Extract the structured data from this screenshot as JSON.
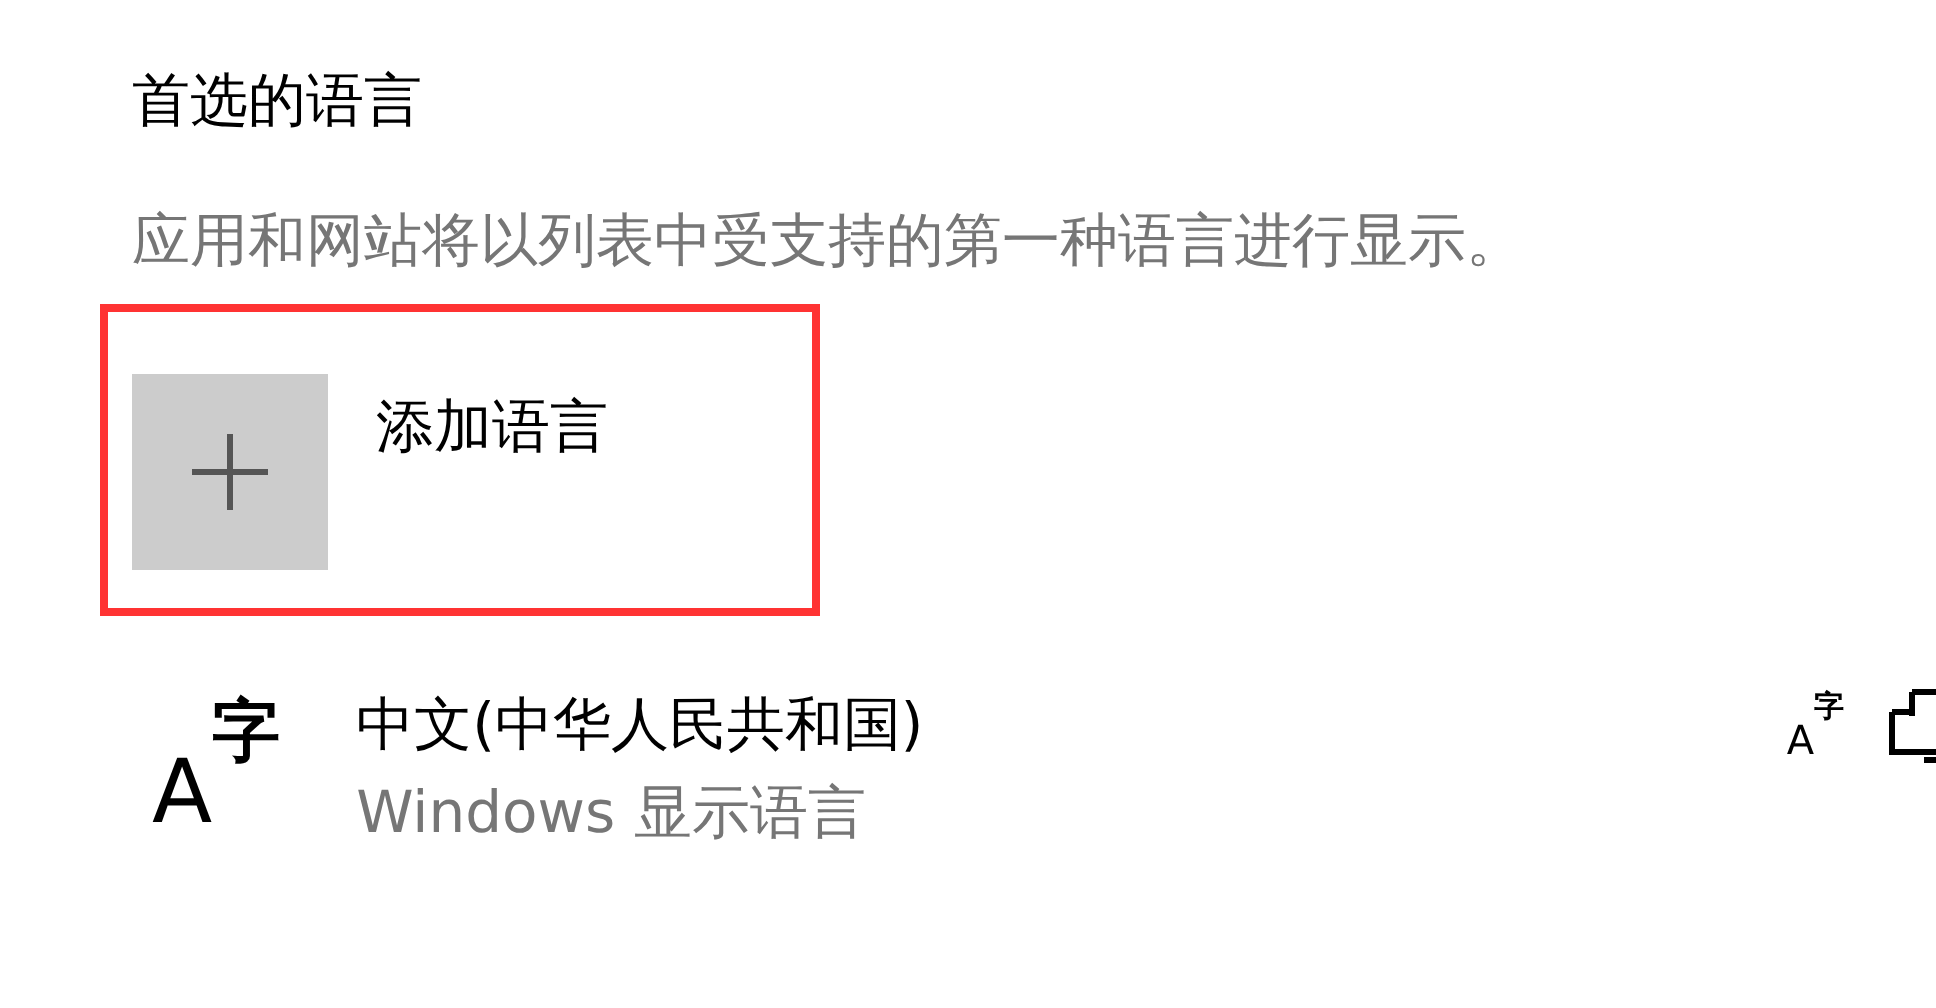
{
  "section": {
    "title": "首选的语言",
    "description": "应用和网站将以列表中受支持的第一种语言进行显示。"
  },
  "add_language": {
    "label": "添加语言",
    "highlighted": true
  },
  "languages": [
    {
      "icon_main": "A",
      "icon_raised": "字",
      "name": "中文(中华人民共和国)",
      "subtitle": "Windows 显示语言",
      "feature_icon_main": "A",
      "feature_icon_raised": "字"
    }
  ]
}
